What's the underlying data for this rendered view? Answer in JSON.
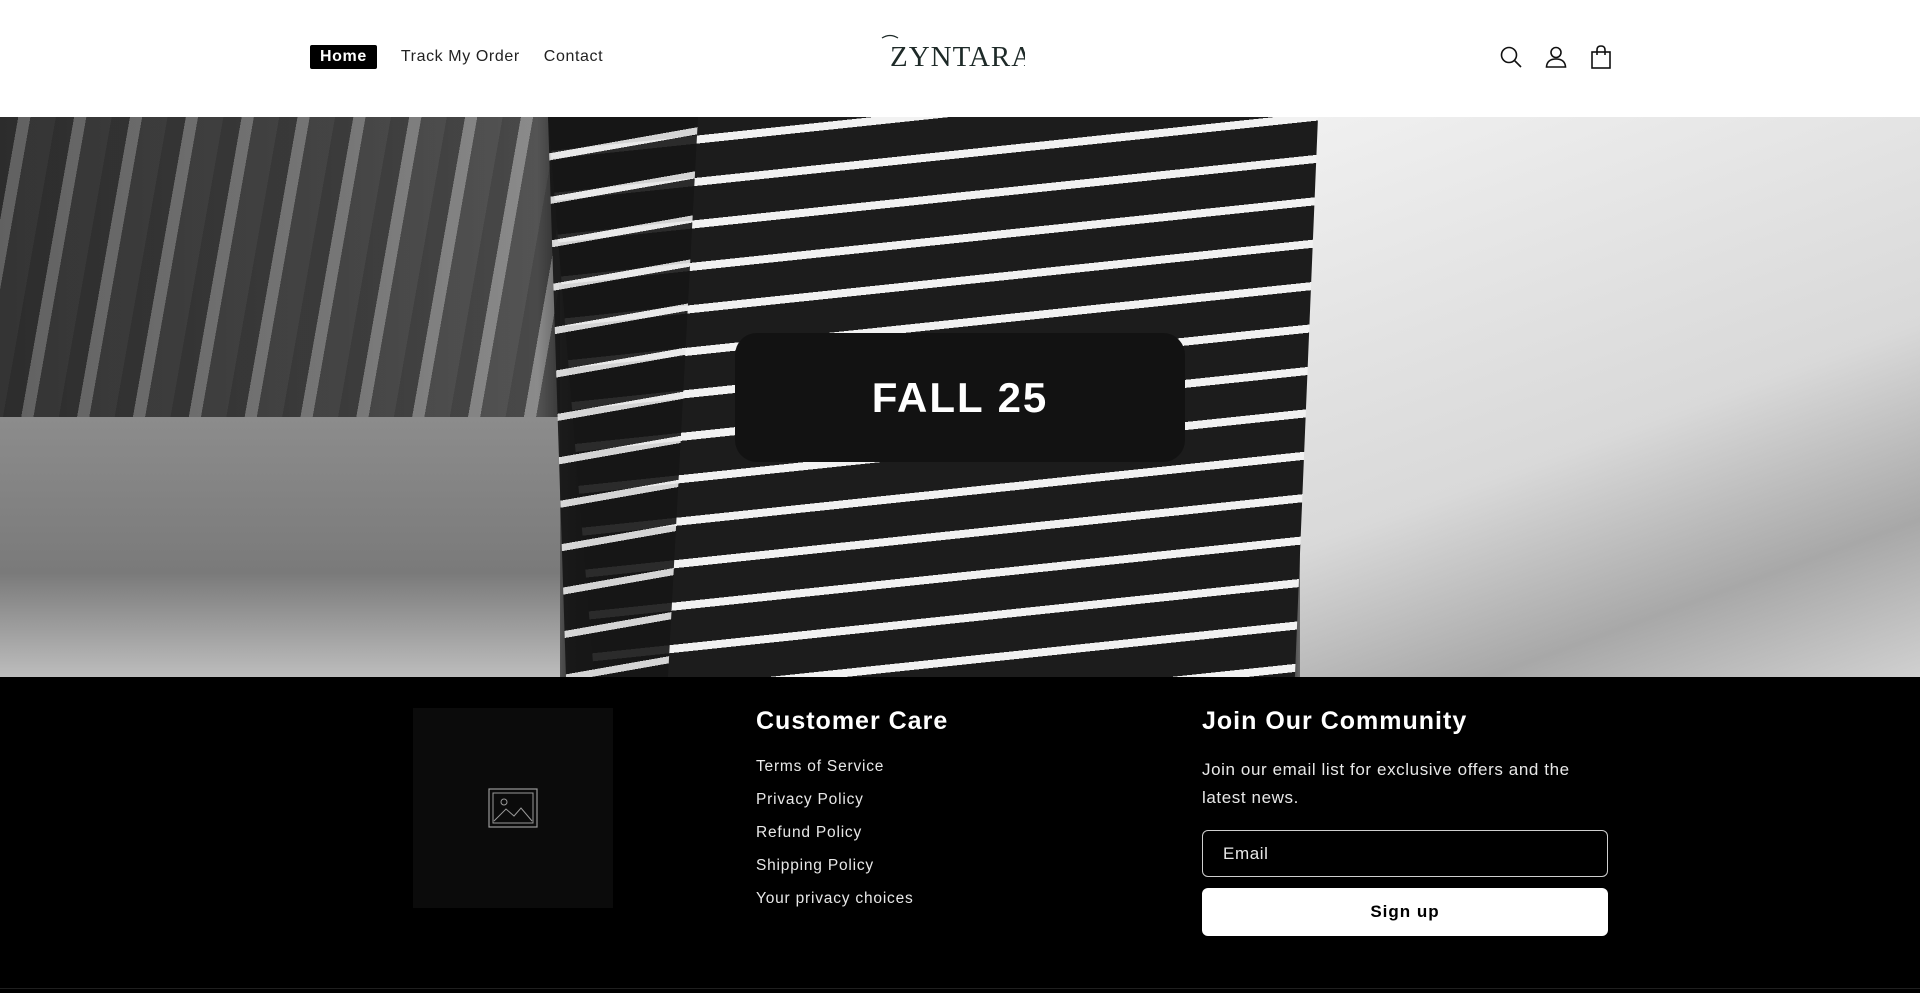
{
  "header": {
    "nav": [
      {
        "label": "Home",
        "active": true
      },
      {
        "label": "Track My Order",
        "active": false
      },
      {
        "label": "Contact",
        "active": false
      }
    ],
    "logo_text": "ZYNTARA",
    "icons": [
      "search-icon",
      "account-icon",
      "cart-icon"
    ]
  },
  "hero": {
    "title": "FALL 25"
  },
  "footer": {
    "image_placeholder_icon": "image-icon",
    "customer_care": {
      "heading": "Customer Care",
      "links": [
        "Terms of Service",
        "Privacy Policy",
        "Refund Policy",
        "Shipping Policy",
        "Your privacy choices"
      ]
    },
    "community": {
      "heading": "Join Our Community",
      "text": "Join our email list for exclusive offers and the latest news.",
      "email_placeholder": "Email",
      "signup_label": "Sign up"
    }
  },
  "colors": {
    "header_bg": "#ffffff",
    "footer_bg": "#000000",
    "hero_card_bg": "#121212",
    "active_nav_bg": "#000000"
  }
}
